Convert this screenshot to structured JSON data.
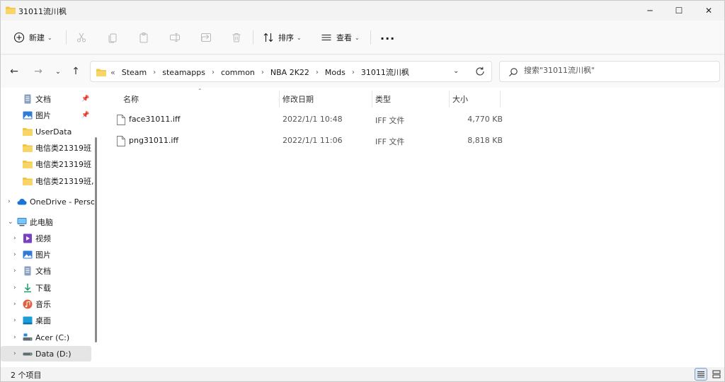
{
  "window": {
    "title": "31011流川枫"
  },
  "controls": {
    "minimize": "─",
    "maximize": "☐",
    "close": "✕"
  },
  "commandbar": {
    "new_label": "新建",
    "sort_label": "排序",
    "view_label": "查看",
    "more": "···"
  },
  "address": {
    "lead": "«",
    "crumbs": [
      "Steam",
      "steamapps",
      "common",
      "NBA 2K22",
      "Mods",
      "31011流川枫"
    ]
  },
  "search": {
    "placeholder": "搜索\"31011流川枫\""
  },
  "sidebar": {
    "items": [
      {
        "label": "文档",
        "pinned": true
      },
      {
        "label": "图片",
        "pinned": true
      },
      {
        "label": "UserData"
      },
      {
        "label": "电信类21319班"
      },
      {
        "label": "电信类21319班"
      },
      {
        "label": "电信类21319班,"
      },
      {
        "label": "OneDrive - Perso"
      },
      {
        "label": "此电脑"
      },
      {
        "label": "视频"
      },
      {
        "label": "图片"
      },
      {
        "label": "文档"
      },
      {
        "label": "下载"
      },
      {
        "label": "音乐"
      },
      {
        "label": "桌面"
      },
      {
        "label": "Acer (C:)"
      },
      {
        "label": "Data (D:)"
      }
    ]
  },
  "columns": {
    "name": "名称",
    "date": "修改日期",
    "type": "类型",
    "size": "大小"
  },
  "files": [
    {
      "name": "face31011.iff",
      "date": "2022/1/1 10:48",
      "type": "IFF 文件",
      "size": "4,770 KB"
    },
    {
      "name": "png31011.iff",
      "date": "2022/1/1 11:06",
      "type": "IFF 文件",
      "size": "8,818 KB"
    }
  ],
  "status": {
    "count": "2 个项目"
  },
  "colors": {
    "folder": "#f4c542",
    "accent": "#0067c0",
    "selected": "#e5e5e5"
  }
}
